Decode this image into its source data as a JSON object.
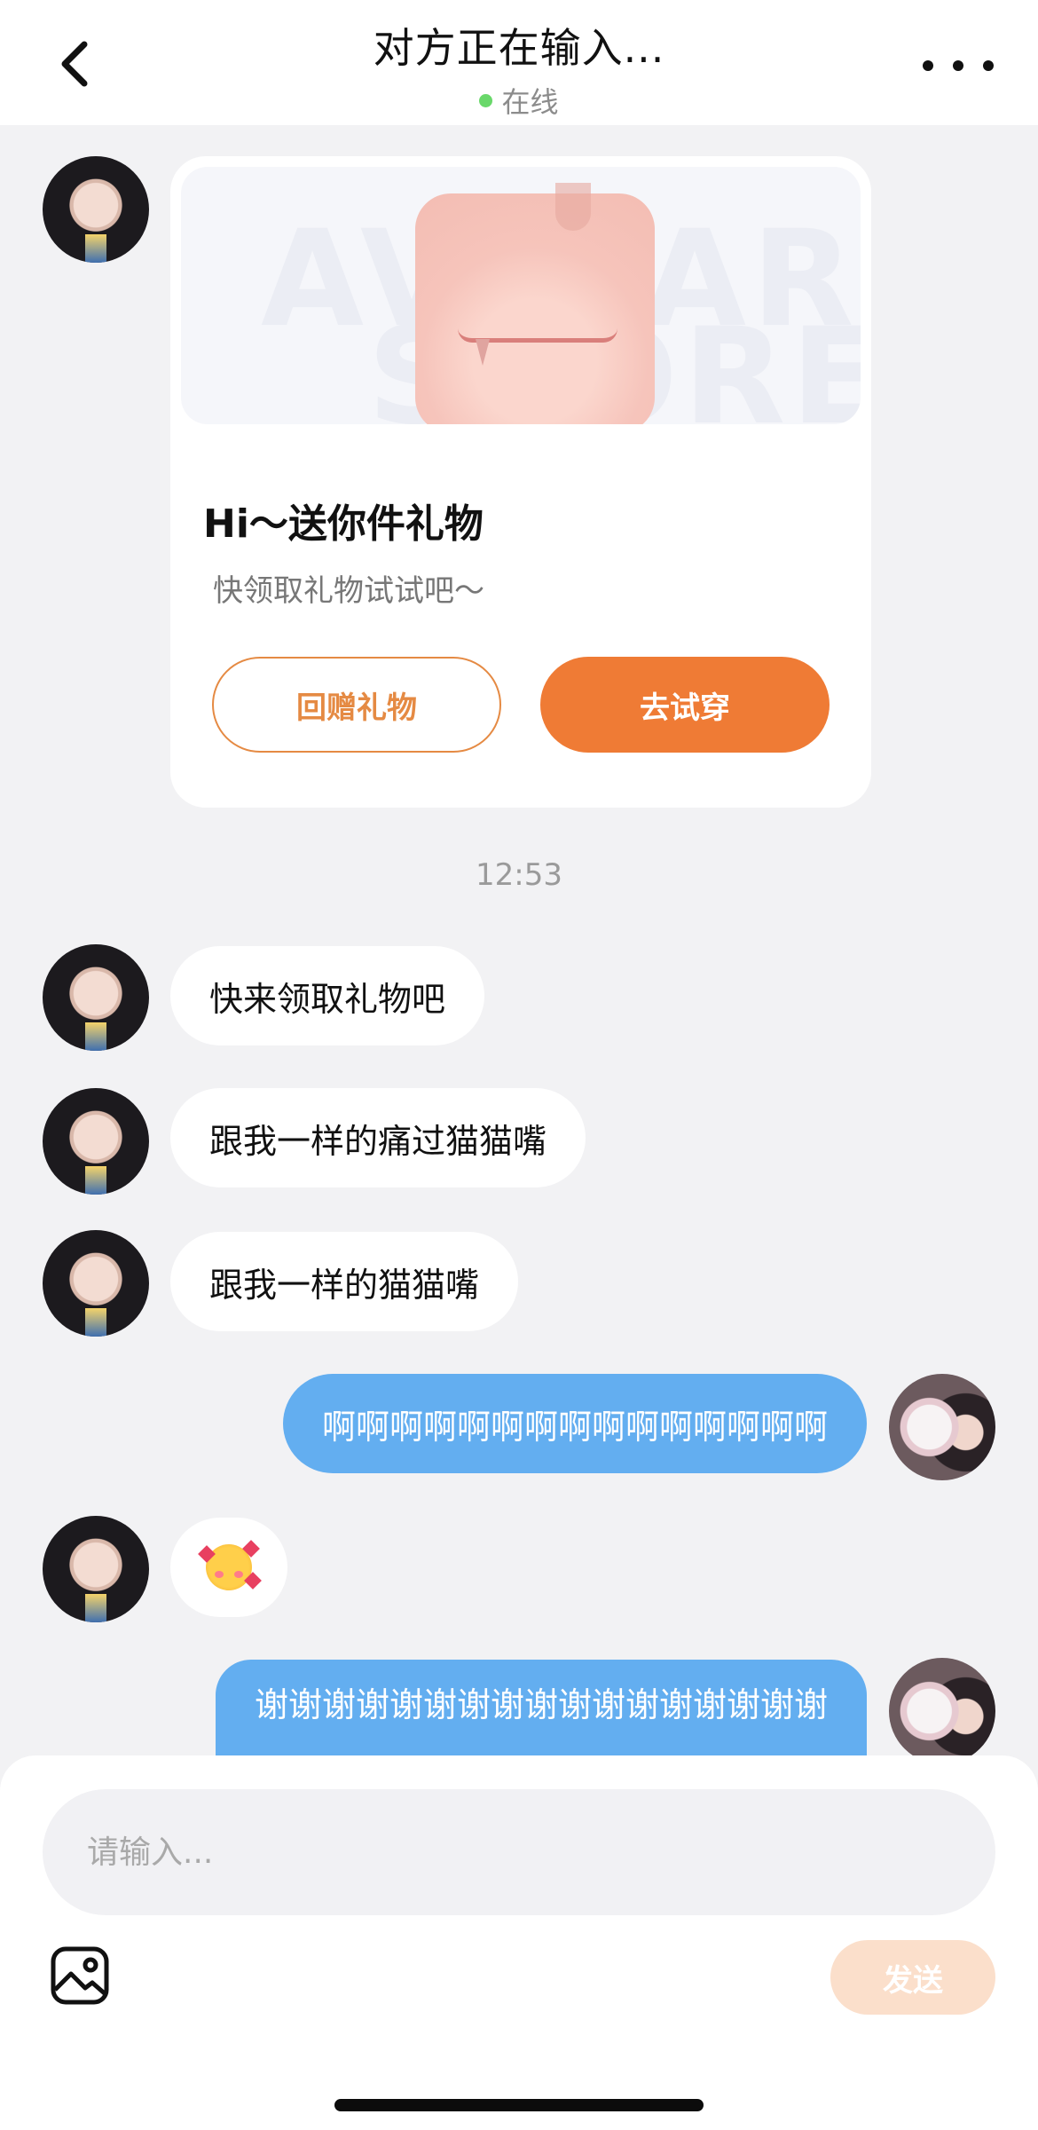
{
  "header": {
    "title": "对方正在输入...",
    "status": "在线",
    "status_color": "#69d86a"
  },
  "gift_card": {
    "title": "Hi～送你件礼物",
    "subtitle": "快领取礼物试试吧～",
    "watermark_line1": "AVATAR",
    "watermark_line2": "STORE",
    "return_gift_label": "回赠礼物",
    "try_on_label": "去试穿",
    "accent_color": "#ef7b35"
  },
  "timestamp": "12:53",
  "messages": [
    {
      "side": "in",
      "text": "快来领取礼物吧"
    },
    {
      "side": "in",
      "text": "跟我一样的痛过猫猫嘴"
    },
    {
      "side": "in",
      "text": "跟我一样的猫猫嘴"
    },
    {
      "side": "out",
      "text": "啊啊啊啊啊啊啊啊啊啊啊啊啊啊啊"
    },
    {
      "side": "in",
      "text": "",
      "emoji": "smiling-face-with-hearts-emoji"
    },
    {
      "side": "out",
      "text": "谢谢谢谢谢谢谢谢谢谢谢谢谢谢谢谢谢",
      "clipped": true
    }
  ],
  "composer": {
    "placeholder": "请输入...",
    "send_label": "发送",
    "image_icon": "image-icon"
  },
  "colors": {
    "outgoing_bubble": "#63aef0",
    "incoming_bubble": "#ffffff",
    "background": "#f2f2f4",
    "send_disabled": "#fbdfcb"
  }
}
